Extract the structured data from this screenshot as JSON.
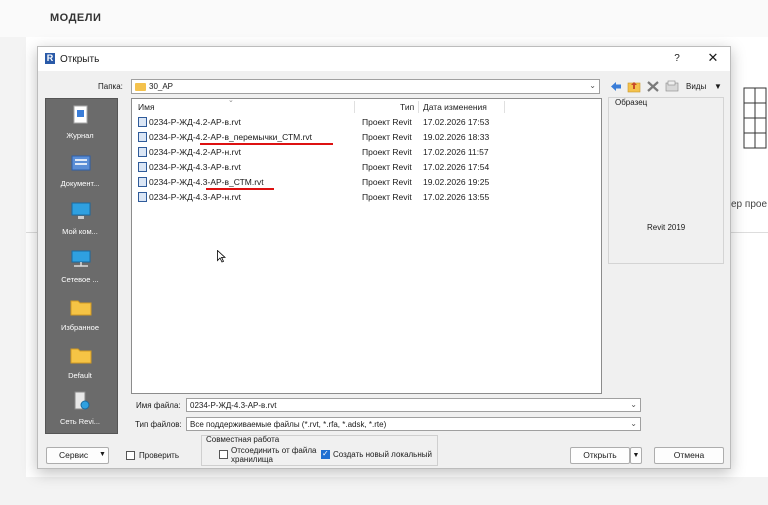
{
  "background_app": {
    "title": "МОДЕЛИ",
    "side_text": "ер прое"
  },
  "dialog": {
    "title": "Открыть",
    "help_label": "?",
    "close_label": "✕",
    "folder_label": "Папка:",
    "folder_value": "30_АР",
    "views_label": "Виды",
    "places": [
      {
        "label": "Журнал",
        "icon": "history-icon"
      },
      {
        "label": "Документ...",
        "icon": "documents-icon"
      },
      {
        "label": "Мой ком...",
        "icon": "computer-icon"
      },
      {
        "label": "Сетевое ...",
        "icon": "network-icon"
      },
      {
        "label": "Избранное",
        "icon": "folder-icon"
      },
      {
        "label": "Default",
        "icon": "folder-icon"
      },
      {
        "label": "Сеть Revi...",
        "icon": "revit-server-icon"
      }
    ],
    "columns": {
      "name": "Имя",
      "type": "Тип",
      "date": "Дата изменения"
    },
    "files": [
      {
        "name": "0234-Р-ЖД-4.2-АР-в.rvt",
        "type": "Проект Revit",
        "date": "17.02.2026 17:53"
      },
      {
        "name": "0234-Р-ЖД-4.2-АР-в_перемычки_СТМ.rvt",
        "type": "Проект Revit",
        "date": "19.02.2026 18:33"
      },
      {
        "name": "0234-Р-ЖД-4.2-АР-н.rvt",
        "type": "Проект Revit",
        "date": "17.02.2026 11:57"
      },
      {
        "name": "0234-Р-ЖД-4.3-АР-в.rvt",
        "type": "Проект Revit",
        "date": "17.02.2026 17:54"
      },
      {
        "name": "0234-Р-ЖД-4.3-АР-в_СТМ.rvt",
        "type": "Проект Revit",
        "date": "19.02.2026 19:25"
      },
      {
        "name": "0234-Р-ЖД-4.3-АР-н.rvt",
        "type": "Проект Revit",
        "date": "17.02.2026 13:55"
      }
    ],
    "preview_label": "Образец",
    "revit_version": "Revit 2019",
    "filename_label": "Имя файла:",
    "filename_value": "0234-Р-ЖД-4.3-АР-в.rvt",
    "filetype_label": "Тип файлов:",
    "filetype_value": "Все поддерживаемые файлы  (*.rvt, *.rfa, *.adsk, *.rte)",
    "collab_title": "Совместная работа",
    "detach_label": "Отсоединить от файла хранилища",
    "detach_checked": false,
    "create_local_label": "Создать новый локальный",
    "create_local_checked": true,
    "service_label": "Сервис",
    "audit_label": "Проверить",
    "audit_checked": false,
    "open_label": "Открыть",
    "cancel_label": "Отмена"
  }
}
